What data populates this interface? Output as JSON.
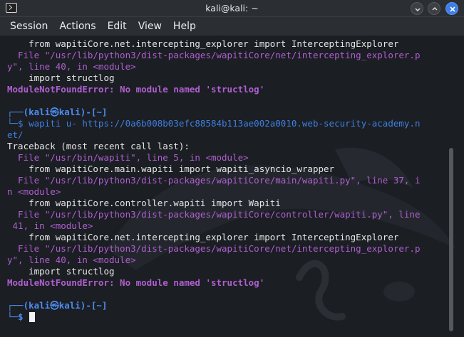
{
  "window": {
    "title": "kali@kali: ~",
    "icon": "terminal-icon",
    "buttons": [
      "minimize-icon",
      "maximize-icon",
      "close-icon"
    ],
    "accent": "#3d7de6"
  },
  "menu": [
    "Session",
    "Actions",
    "Edit",
    "View",
    "Help"
  ],
  "terminal": {
    "lines": [
      "    from wapitiCore.net.intercepting_explorer import InterceptingExplorer",
      "  File \"/usr/lib/python3/dist-packages/wapitiCore/net/intercepting_explorer.p",
      "y\", line 40, in <module>",
      "    import structlog",
      "ModuleNotFoundError: No module named 'structlog'",
      "",
      "┌──(kali㉿kali)-[~]",
      "└─$ wapiti u- https://0a6b008b03efc88584b113ae002a0010.web-security-academy.n",
      "et/",
      "Traceback (most recent call last):",
      "  File \"/usr/bin/wapiti\", line 5, in <module>",
      "    from wapitiCore.main.wapiti import wapiti_asyncio_wrapper",
      "  File \"/usr/lib/python3/dist-packages/wapitiCore/main/wapiti.py\", line 37, i",
      "n <module>",
      "    from wapitiCore.controller.wapiti import Wapiti",
      "  File \"/usr/lib/python3/dist-packages/wapitiCore/controller/wapiti.py\", line",
      " 41, in <module>",
      "    from wapitiCore.net.intercepting_explorer import InterceptingExplorer",
      "  File \"/usr/lib/python3/dist-packages/wapitiCore/net/intercepting_explorer.p",
      "y\", line 40, in <module>",
      "    import structlog",
      "ModuleNotFoundError: No module named 'structlog'",
      "",
      "┌──(kali㉿kali)-[~]",
      "└─$ "
    ],
    "colors": {
      "background": "#1b1e23",
      "text": "#e6e6e6",
      "path": "#b05fd0",
      "prompt": "#3f7fe0"
    }
  }
}
